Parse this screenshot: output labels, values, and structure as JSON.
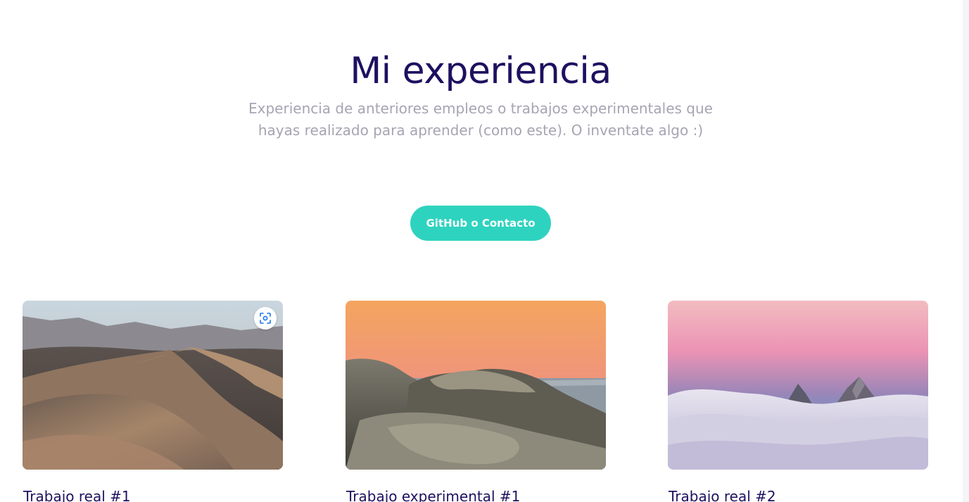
{
  "section": {
    "title": "Mi experiencia",
    "subtitle": "Experiencia de anteriores empleos o trabajos experimentales que hayas realizado para aprender (como este). O inventate algo :)",
    "cta_label": "GitHub o Contacto"
  },
  "cards": [
    {
      "title": "Trabajo real #1",
      "image": "desert-dunes"
    },
    {
      "title": "Trabajo experimental #1",
      "image": "coastal-rocks-sunset"
    },
    {
      "title": "Trabajo real #2",
      "image": "mountain-peaks-above-clouds"
    }
  ],
  "overlay": {
    "icon": "visual-search-lens-icon"
  },
  "colors": {
    "title": "#1d1160",
    "subtitle": "#a7a4b3",
    "accent": "#2ed3bf",
    "background": "#ffffff"
  }
}
